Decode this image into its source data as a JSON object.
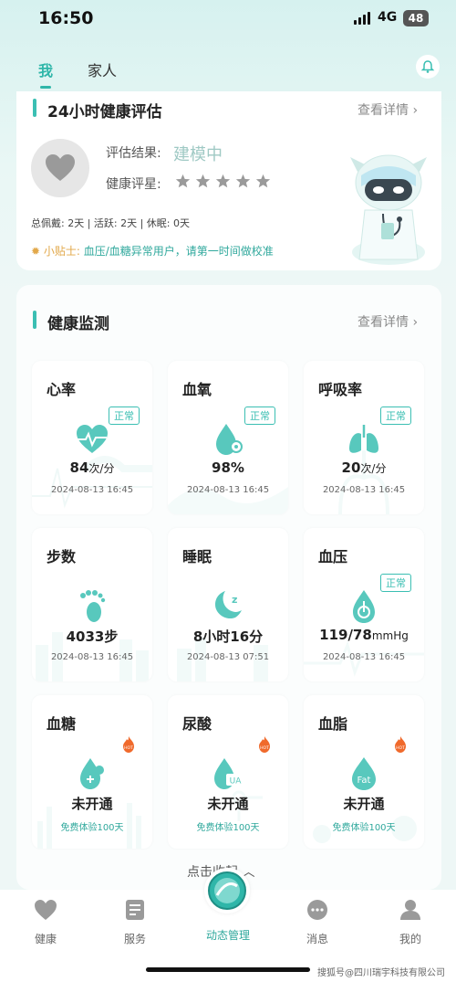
{
  "status_bar": {
    "time": "16:50",
    "network": "4G",
    "battery": "48"
  },
  "top_tabs": [
    {
      "label": "我",
      "active": true
    },
    {
      "label": "家人",
      "active": false
    }
  ],
  "assessment": {
    "title": "24小时健康评估",
    "more": "查看详情",
    "result_label": "评估结果:",
    "result_value": "建模中",
    "rating_label": "健康评星:",
    "stars_filled": 0,
    "stars_total": 5,
    "stats": "总佩戴: 2天 | 活跃: 2天 | 休眠: 0天",
    "tip_label": "小贴士:",
    "tip_text": "血压/血糖异常用户，请第一时间做校准"
  },
  "monitor": {
    "title": "健康监测",
    "more": "查看详情",
    "tiles": [
      {
        "title": "心率",
        "badge": "正常",
        "icon": "heart-rate-icon",
        "value": "84",
        "unit": "次/分",
        "date": "2024-08-13 16:45"
      },
      {
        "title": "血氧",
        "badge": "正常",
        "icon": "blood-oxygen-icon",
        "value": "98%",
        "unit": "",
        "date": "2024-08-13 16:45"
      },
      {
        "title": "呼吸率",
        "badge": "正常",
        "icon": "lungs-icon",
        "value": "20",
        "unit": "次/分",
        "date": "2024-08-13 16:45"
      },
      {
        "title": "步数",
        "badge": "",
        "icon": "footprint-icon",
        "value": "4033步",
        "unit": "",
        "date": "2024-08-13 16:45"
      },
      {
        "title": "睡眠",
        "badge": "",
        "icon": "moon-sleep-icon",
        "value": "8小时16分",
        "unit": "",
        "date": "2024-08-13 07:51"
      },
      {
        "title": "血压",
        "badge": "正常",
        "icon": "blood-pressure-icon",
        "value": "119/78",
        "unit": "mmHg",
        "date": "2024-08-13 16:45"
      },
      {
        "title": "血糖",
        "badge": "",
        "hot": "HOT",
        "icon": "blood-sugar-icon",
        "value": "未开通",
        "unit": "",
        "trial": "免费体验100天"
      },
      {
        "title": "尿酸",
        "badge": "",
        "hot": "HOT",
        "icon": "uric-acid-icon",
        "icon_text": "UA",
        "value": "未开通",
        "unit": "",
        "trial": "免费体验100天"
      },
      {
        "title": "血脂",
        "badge": "",
        "hot": "HOT",
        "icon": "blood-fat-icon",
        "icon_text": "Fat",
        "value": "未开通",
        "unit": "",
        "trial": "免费体验100天"
      }
    ],
    "collapse": "点击收起"
  },
  "nav": {
    "items": [
      {
        "label": "健康",
        "icon": "heart-icon",
        "active": false
      },
      {
        "label": "服务",
        "icon": "service-icon",
        "active": false
      },
      {
        "label": "动态管理",
        "icon": "dynamic-management-icon",
        "active": true
      },
      {
        "label": "消息",
        "icon": "message-icon",
        "active": false
      },
      {
        "label": "我的",
        "icon": "profile-icon",
        "active": false
      }
    ]
  },
  "watermark": "搜狐号@四川瑞宇科技有限公司",
  "colors": {
    "accent": "#3bbfb3",
    "hot": "#f06a2c",
    "star": "#9a9a9a"
  }
}
